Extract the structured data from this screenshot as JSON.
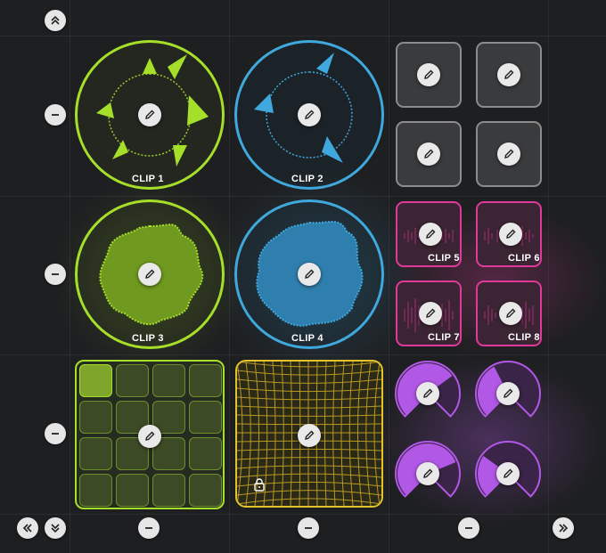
{
  "colors": {
    "background": "#1e1f21",
    "green": "#a6df2a",
    "blue": "#3fa8dc",
    "gray": "#8c8c8c",
    "pink": "#e0399a",
    "yellow": "#e3c32c",
    "purple": "#b258e6"
  },
  "icons": {
    "edit": "pencil-icon",
    "remove": "minus-icon",
    "collapse_up": "chevrons-up-icon",
    "collapse_down": "chevrons-down-icon",
    "page_left": "double-chevron-left-icon",
    "page_right": "double-chevron-right-icon",
    "lock": "lock-icon"
  },
  "clips": {
    "clip1": "CLIP 1",
    "clip2": "CLIP 2",
    "clip3": "CLIP 3",
    "clip4": "CLIP 4",
    "clip5": "CLIP 5",
    "clip6": "CLIP 6",
    "clip7": "CLIP 7",
    "clip8": "CLIP 8"
  },
  "pad_grid": {
    "rows": 4,
    "cols": 4,
    "active_cell": 1
  },
  "xy_pad": {
    "locked": true
  },
  "knobs": [
    {
      "level": 0.7
    },
    {
      "level": 0.4
    },
    {
      "level": 0.75
    },
    {
      "level": 0.3
    }
  ]
}
